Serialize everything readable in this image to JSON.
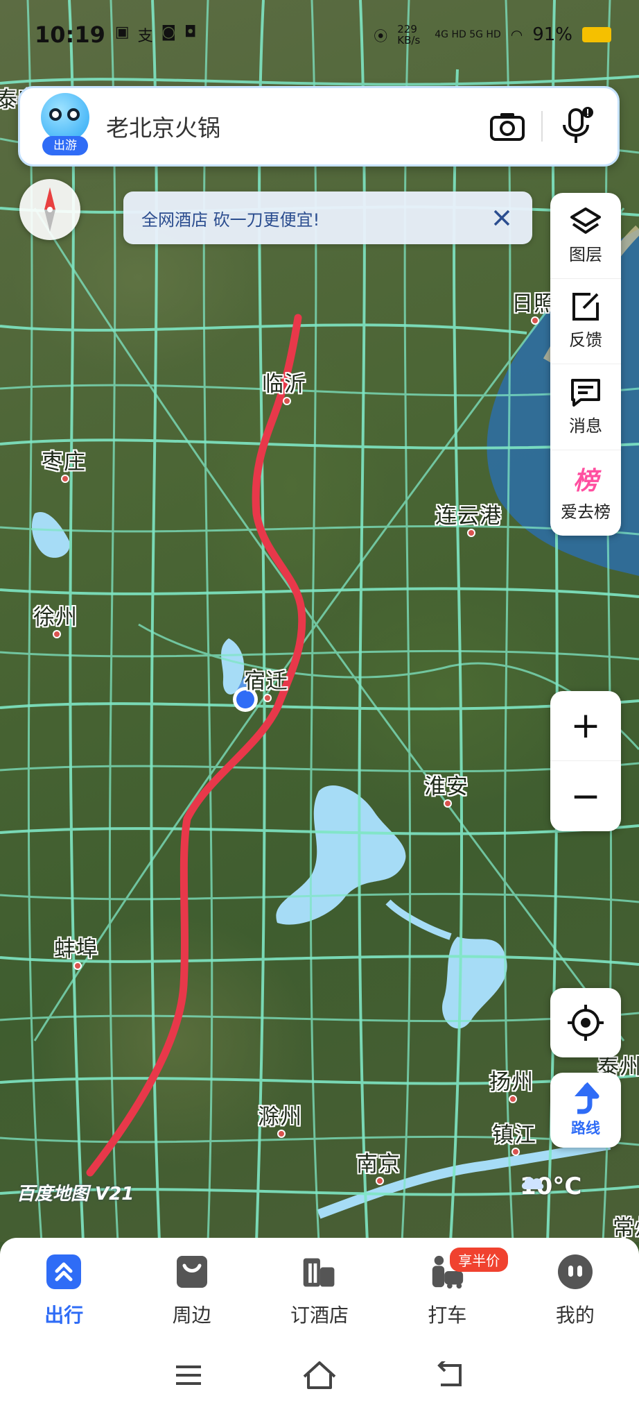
{
  "status_bar": {
    "time": "10:19",
    "net_speed": "229 KB/s",
    "signal": "4G HD 5G HD",
    "battery": "91%"
  },
  "search": {
    "badge": "出游",
    "query": "老北京火锅",
    "camera_icon": "camera-icon",
    "mic_icon": "microphone-icon"
  },
  "toast": {
    "message": "全网酒店 砍一刀更便宜!",
    "close_icon": "close-icon"
  },
  "tools": [
    {
      "icon": "layers-icon",
      "label": "图层"
    },
    {
      "icon": "feedback-icon",
      "label": "反馈"
    },
    {
      "icon": "message-icon",
      "label": "消息"
    },
    {
      "icon": "ranking-icon",
      "label": "爱去榜",
      "glyph": "榜"
    }
  ],
  "zoom": {
    "in": "+",
    "out": "−"
  },
  "route": {
    "label": "路线"
  },
  "map": {
    "cities": [
      {
        "name": "泰安",
        "partial": "泰安"
      },
      {
        "name": "临沂"
      },
      {
        "name": "日照"
      },
      {
        "name": "枣庄"
      },
      {
        "name": "连云港"
      },
      {
        "name": "徐州"
      },
      {
        "name": "宿迁"
      },
      {
        "name": "淮安"
      },
      {
        "name": "蚌埠"
      },
      {
        "name": "扬州"
      },
      {
        "name": "泰州"
      },
      {
        "name": "镇江"
      },
      {
        "name": "滁州"
      },
      {
        "name": "南京"
      },
      {
        "name": "常州"
      }
    ],
    "watermark": "百度地图 V21",
    "weather": "10°C",
    "route_color": "#e8384a"
  },
  "bottom_tabs": [
    {
      "label": "出行",
      "active": true,
      "icon": "travel-icon"
    },
    {
      "label": "周边",
      "active": false,
      "icon": "nearby-icon"
    },
    {
      "label": "订酒店",
      "active": false,
      "icon": "hotel-icon"
    },
    {
      "label": "打车",
      "active": false,
      "icon": "taxi-icon",
      "promo": "享半价"
    },
    {
      "label": "我的",
      "active": false,
      "icon": "profile-icon"
    }
  ],
  "system_nav": [
    "menu-icon",
    "home-icon",
    "back-icon"
  ]
}
